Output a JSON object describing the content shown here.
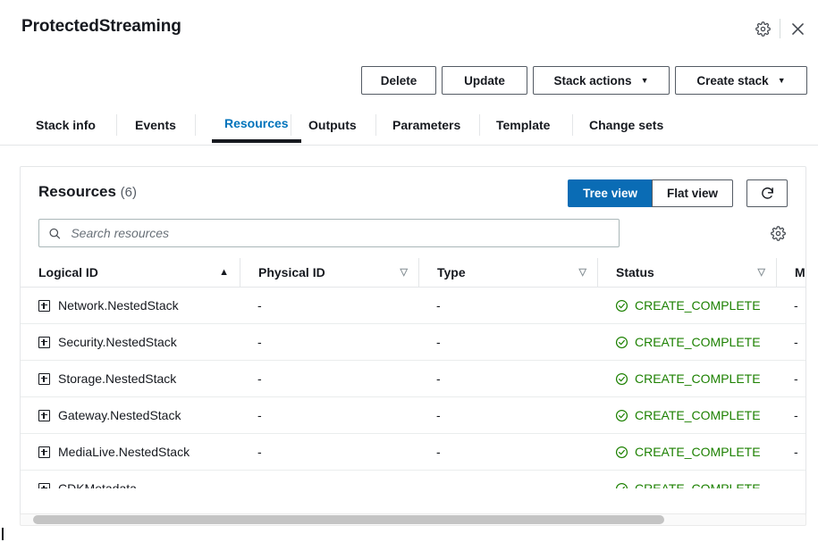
{
  "header": {
    "stack_title": "ProtectedStreaming",
    "settings_icon": "gear-icon",
    "close_icon": "close-icon"
  },
  "actions": {
    "delete": "Delete",
    "update": "Update",
    "stack_actions": "Stack actions",
    "create_stack": "Create stack",
    "caret": "▼"
  },
  "tabs": [
    {
      "label": "Stack info",
      "active": false
    },
    {
      "label": "Events",
      "active": false
    },
    {
      "label": "Resources",
      "active": true
    },
    {
      "label": "Outputs",
      "active": false
    },
    {
      "label": "Parameters",
      "active": false
    },
    {
      "label": "Template",
      "active": false
    },
    {
      "label": "Change sets",
      "active": false
    }
  ],
  "panel": {
    "title": "Resources",
    "count": "(6)",
    "tree_view": "Tree view",
    "flat_view": "Flat view",
    "selected_view": "Tree view",
    "refresh_icon": "refresh-icon",
    "settings_icon": "gear-icon",
    "accent_color": "#0a6cb5",
    "status_color": "#1d8102"
  },
  "search": {
    "placeholder": "Search resources",
    "value": "",
    "icon": "search-icon"
  },
  "table": {
    "columns": [
      {
        "label": "Logical ID",
        "sort": "▲",
        "sorted": true
      },
      {
        "label": "Physical ID",
        "sort": "▽",
        "sorted": false
      },
      {
        "label": "Type",
        "sort": "▽",
        "sorted": false
      },
      {
        "label": "Status",
        "sort": "▽",
        "sorted": false
      },
      {
        "label": "Mo",
        "sort": "",
        "sorted": false
      }
    ],
    "rows": [
      {
        "logical_id": "Network.NestedStack",
        "physical_id": "-",
        "type": "-",
        "status": "CREATE_COMPLETE",
        "module": "-"
      },
      {
        "logical_id": "Security.NestedStack",
        "physical_id": "-",
        "type": "-",
        "status": "CREATE_COMPLETE",
        "module": "-"
      },
      {
        "logical_id": "Storage.NestedStack",
        "physical_id": "-",
        "type": "-",
        "status": "CREATE_COMPLETE",
        "module": "-"
      },
      {
        "logical_id": "Gateway.NestedStack",
        "physical_id": "-",
        "type": "-",
        "status": "CREATE_COMPLETE",
        "module": "-"
      },
      {
        "logical_id": "MediaLive.NestedStack",
        "physical_id": "-",
        "type": "-",
        "status": "CREATE_COMPLETE",
        "module": "-"
      },
      {
        "logical_id": "CDKMetadata",
        "physical_id": "-",
        "type": "-",
        "status": "CREATE_COMPLETE",
        "module": "-"
      }
    ]
  }
}
